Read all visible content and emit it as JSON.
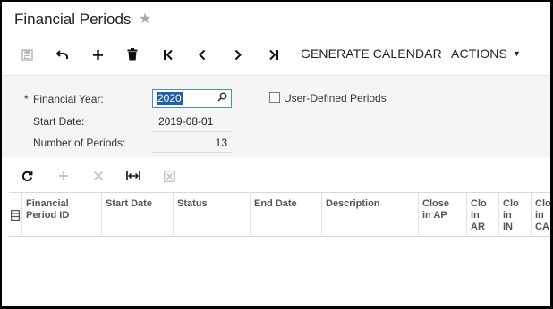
{
  "page": {
    "title": "Financial Periods"
  },
  "toolbar": {
    "generate_calendar": "GENERATE CALENDAR",
    "actions": "ACTIONS"
  },
  "form": {
    "required_mark": "*",
    "financial_year_label": "Financial Year:",
    "financial_year_value": "2020",
    "start_date_label": "Start Date:",
    "start_date_value": "2019-08-01",
    "number_of_periods_label": "Number of Periods:",
    "number_of_periods_value": "13",
    "user_defined_label": "User-Defined Periods",
    "user_defined_checked": false
  },
  "grid": {
    "columns": [
      "Financial\nPeriod ID",
      "Start Date",
      "Status",
      "End Date",
      "Description",
      "Close\nin AP",
      "Clo\nin\nAR",
      "Clo\nin\nIN",
      "Clo\nin\nCA"
    ],
    "rows": []
  },
  "icons": {
    "save": "save-icon",
    "undo": "undo-icon",
    "add": "plus-icon",
    "delete": "trash-icon",
    "first": "first-page-icon",
    "prev": "chevron-left-icon",
    "next": "chevron-right-icon",
    "last": "last-page-icon",
    "refresh": "refresh-icon",
    "fit_columns": "fit-columns-icon",
    "export": "export-excel-icon"
  },
  "colors": {
    "selection": "#1e5fa8",
    "focus_border": "#4a90c8",
    "form_bg": "#f5f5f5",
    "disabled_icon": "#bbbbbb"
  }
}
